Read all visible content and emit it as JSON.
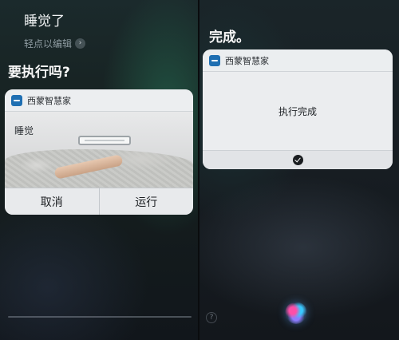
{
  "left": {
    "utterance": "睡觉了",
    "edit_hint": "轻点以编辑",
    "question": "要执行吗?",
    "card": {
      "app_name": "西蒙智慧家",
      "shortcut_label": "睡觉",
      "cancel_label": "取消",
      "run_label": "运行"
    }
  },
  "right": {
    "status": "完成。",
    "card": {
      "app_name": "西蒙智慧家",
      "result_text": "执行完成"
    }
  },
  "icons": {
    "app": "app-icon",
    "edit_chevron": "chevron-right-icon",
    "check": "checkmark-icon",
    "siri": "siri-orb-icon",
    "help": "question-icon"
  },
  "colors": {
    "app_icon": "#1f6fb2",
    "card_bg": "#e2e4e7",
    "background_dark": "#11161b"
  }
}
